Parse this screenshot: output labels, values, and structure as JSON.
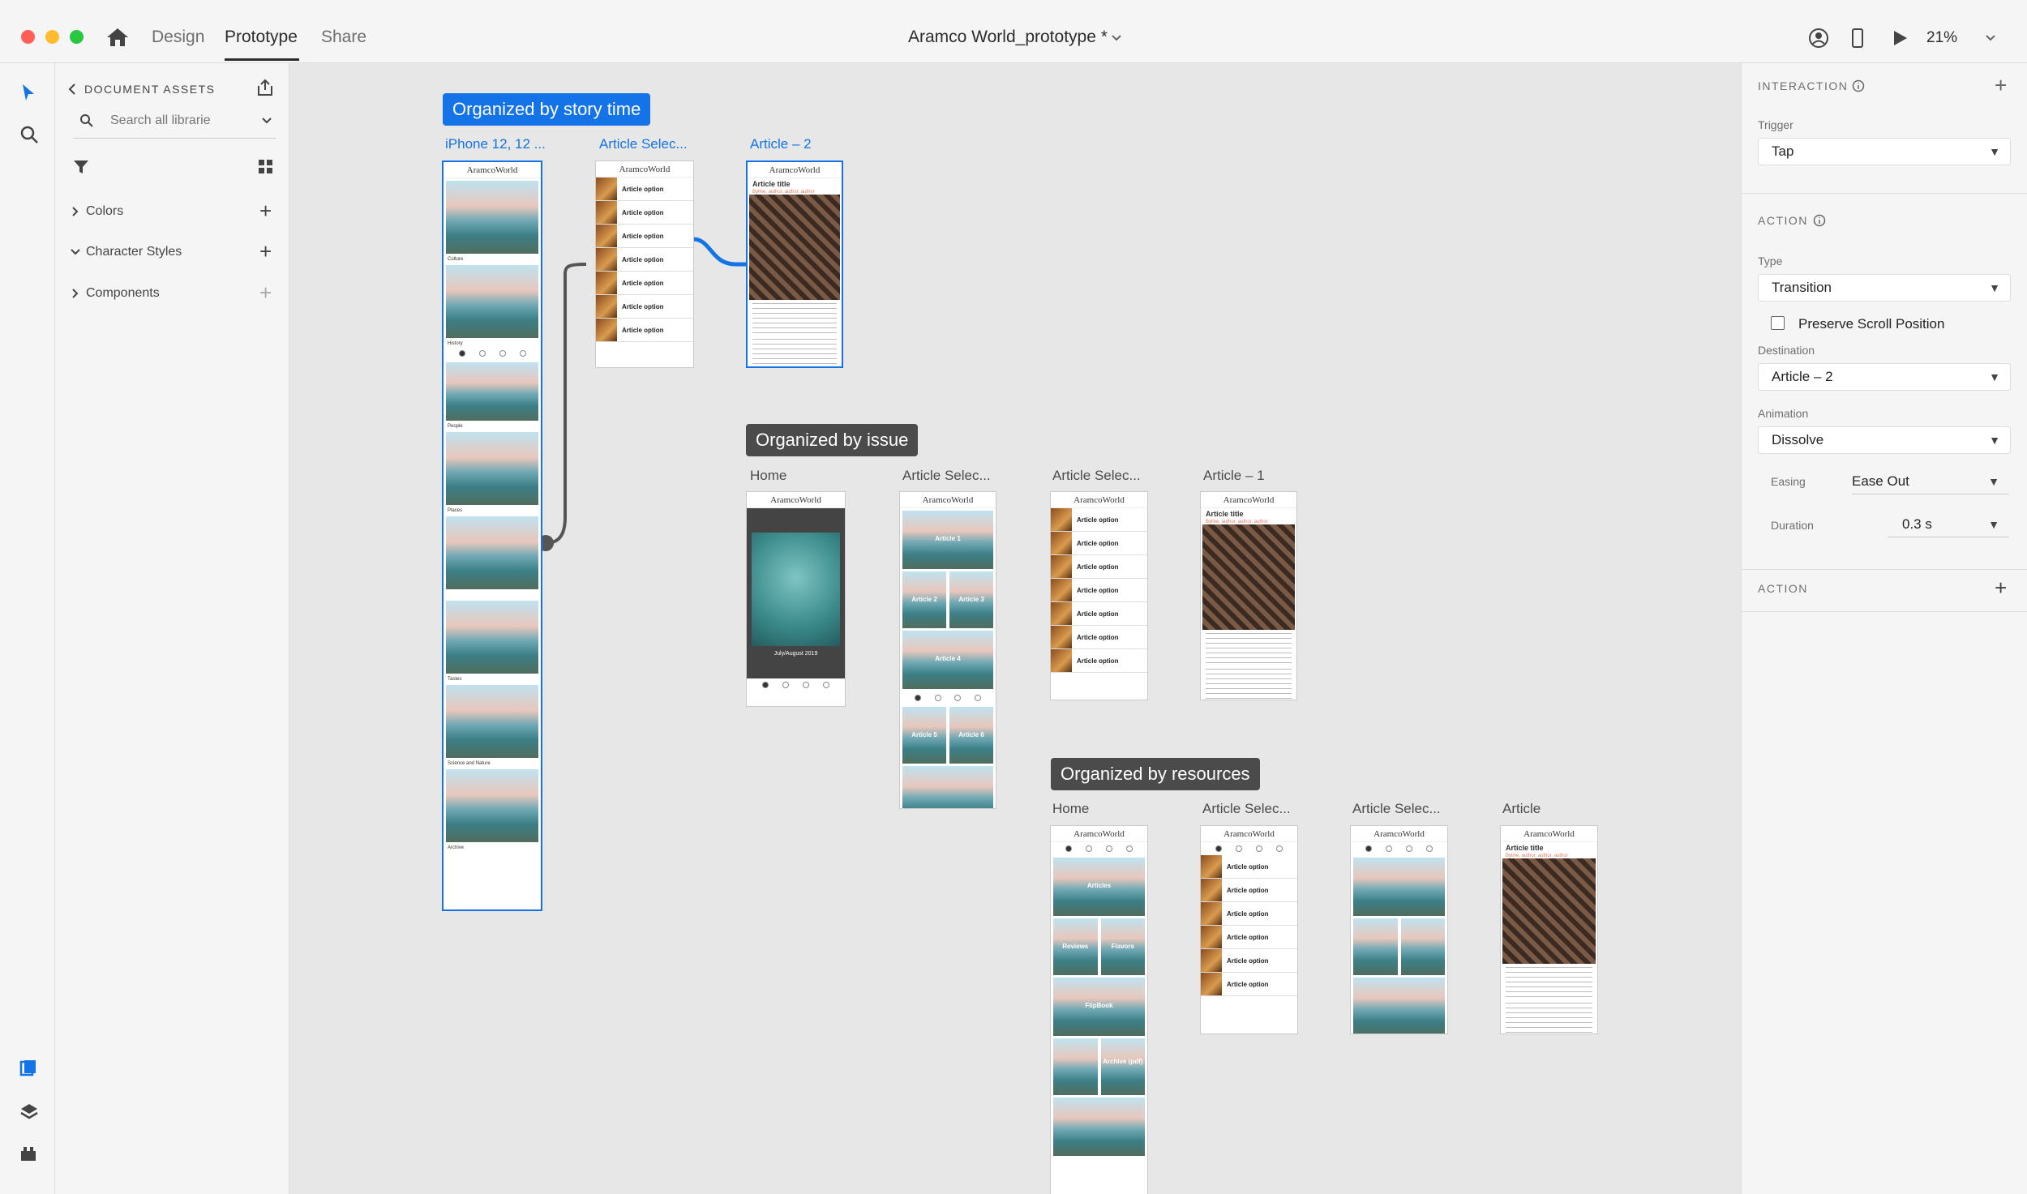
{
  "titlebar": {
    "tabs": [
      "Design",
      "Prototype",
      "Share"
    ],
    "active_tab": "Prototype",
    "document_title": "Aramco World_prototype *",
    "zoom": "21%"
  },
  "assets": {
    "header": "DOCUMENT ASSETS",
    "search_placeholder": "Search all librarie",
    "sections": [
      "Colors",
      "Character Styles",
      "Components"
    ]
  },
  "canvas": {
    "groups": [
      {
        "label": "Organized by story time",
        "color": "#1473e6"
      },
      {
        "label": "Organized by issue",
        "color": "#4b4b4b"
      },
      {
        "label": "Organized by resources",
        "color": "#4b4b4b"
      }
    ],
    "artboard_labels": {
      "story": [
        "iPhone 12, 12 ...",
        "Article Selec...",
        "Article – 2"
      ],
      "issue": [
        "Home",
        "Article Selec...",
        "Article Selec...",
        "Article – 1"
      ],
      "resources": [
        "Home",
        "Article Selec...",
        "Article Selec...",
        "Article"
      ]
    },
    "logo_text": "AramcoWorld",
    "home_sections": [
      "Culture",
      "History",
      "People",
      "Places",
      "Tastes",
      "Science and Nature",
      "Archive"
    ],
    "list_item": "Article option",
    "article_title": "Article title",
    "article_byline": "Byline, author, author, author",
    "issue_cover_text": "July/August 2019",
    "issue_tiles": [
      "Article 1",
      "Article 2",
      "Article 3",
      "Article 4",
      "Article 5",
      "Article 6"
    ],
    "resource_tiles": [
      "Articles",
      "Reviews",
      "Flavors",
      "FlipBook",
      "Archive (pdf)"
    ]
  },
  "properties": {
    "interaction_header": "INTERACTION",
    "trigger_label": "Trigger",
    "trigger_value": "Tap",
    "action_header": "ACTION",
    "type_label": "Type",
    "type_value": "Transition",
    "preserve_scroll": "Preserve Scroll Position",
    "destination_label": "Destination",
    "destination_value": "Article – 2",
    "animation_label": "Animation",
    "animation_value": "Dissolve",
    "easing_label": "Easing",
    "easing_value": "Ease Out",
    "duration_label": "Duration",
    "duration_value": "0.3 s",
    "action2_header": "ACTION"
  }
}
